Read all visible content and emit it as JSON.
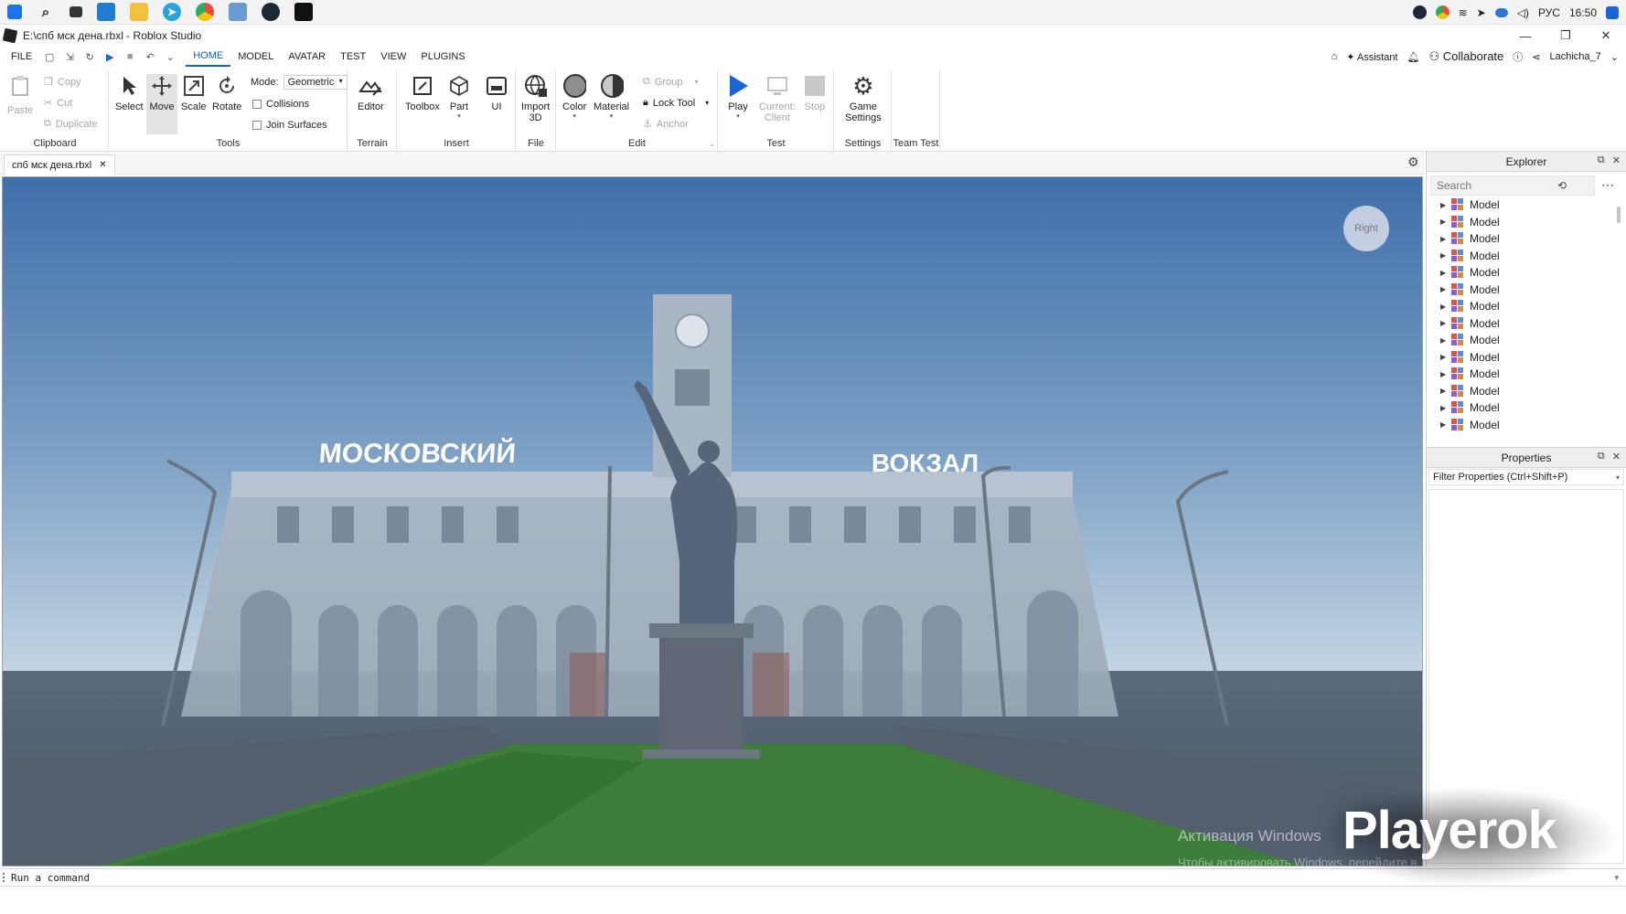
{
  "taskbar": {
    "icons": [
      "windows-start",
      "search",
      "task-view",
      "vscode",
      "file-explorer",
      "telegram",
      "chrome",
      "photos",
      "steam",
      "roblox-studio"
    ],
    "tray": {
      "language": "РУС",
      "time": "16:50"
    }
  },
  "window": {
    "title": "E:\\спб мск дена.rbxl - Roblox Studio"
  },
  "menu": {
    "tabs": [
      "FILE",
      "HOME",
      "MODEL",
      "AVATAR",
      "TEST",
      "VIEW",
      "PLUGINS"
    ],
    "active_tab": "HOME",
    "right": {
      "assistant": "Assistant",
      "collaborate": "Collaborate",
      "user": "Lachicha_7"
    }
  },
  "ribbon": {
    "clipboard": {
      "label": "Clipboard",
      "paste": "Paste",
      "copy": "Copy",
      "cut": "Cut",
      "duplicate": "Duplicate"
    },
    "tools": {
      "label": "Tools",
      "select": "Select",
      "move": "Move",
      "scale": "Scale",
      "rotate": "Rotate",
      "mode_label": "Mode:",
      "mode_value": "Geometric",
      "collisions": "Collisions",
      "join_surfaces": "Join Surfaces"
    },
    "terrain": {
      "label": "Terrain",
      "editor": "Editor"
    },
    "insert": {
      "label": "Insert",
      "toolbox": "Toolbox",
      "part": "Part",
      "ui": "UI"
    },
    "file": {
      "label": "File",
      "import3d_line1": "Import",
      "import3d_line2": "3D"
    },
    "edit": {
      "label": "Edit",
      "color": "Color",
      "material": "Material",
      "group": "Group",
      "lock_tool": "Lock Tool",
      "anchor": "Anchor"
    },
    "test": {
      "label": "Test",
      "play": "Play",
      "current_client_line1": "Current:",
      "current_client_line2": "Client",
      "stop": "Stop"
    },
    "settings": {
      "label": "Settings",
      "game_settings_line1": "Game",
      "game_settings_line2": "Settings"
    },
    "team_test": {
      "label": "Team Test"
    }
  },
  "document_tab": {
    "name": "спб мск дена.rbxl"
  },
  "viewport": {
    "view_cube": "Right",
    "sign_left": "МОСКОВСКИЙ",
    "sign_right": "ВОКЗАЛ",
    "activation_title": "Активация Windows",
    "activation_sub": "Чтобы активировать Windows, перейдите в раздел \"Параметры\"."
  },
  "command_bar": {
    "text": "Run a command"
  },
  "explorer": {
    "title": "Explorer",
    "search_placeholder": "Search",
    "items": [
      "Model",
      "Model",
      "Model",
      "Model",
      "Model",
      "Model",
      "Model",
      "Model",
      "Model",
      "Model",
      "Model",
      "Model",
      "Model",
      "Model",
      "Model"
    ]
  },
  "properties": {
    "title": "Properties",
    "filter_text": "Filter Properties (Ctrl+Shift+P)"
  },
  "overlay": {
    "brand": "Playerok"
  },
  "colors": {
    "accent": "#0b62d0",
    "play": "#1a63d8",
    "sky_top": "#3f6faa",
    "sky_bottom": "#c9d9e6",
    "grass": "#3e7d3a"
  }
}
